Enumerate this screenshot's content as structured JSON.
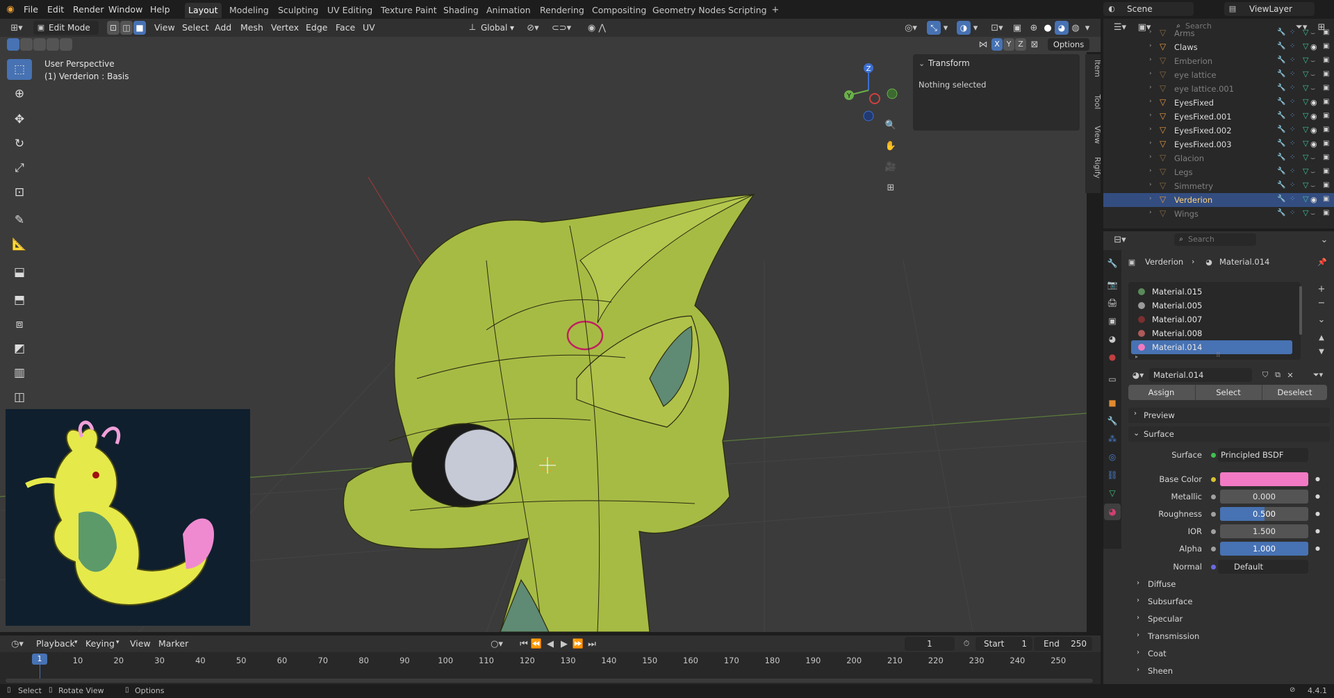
{
  "menus": {
    "file": "File",
    "edit": "Edit",
    "render": "Render",
    "window": "Window",
    "help": "Help"
  },
  "workspaces": [
    "Layout",
    "Modeling",
    "Sculpting",
    "UV Editing",
    "Texture Paint",
    "Shading",
    "Animation",
    "Rendering",
    "Compositing",
    "Geometry Nodes",
    "Scripting"
  ],
  "active_workspace": "Layout",
  "scene": {
    "label": "Scene"
  },
  "view_layer": {
    "label": "ViewLayer"
  },
  "viewport_header": {
    "mode": "Edit Mode",
    "view": "View",
    "select": "Select",
    "add": "Add",
    "mesh": "Mesh",
    "vertex": "Vertex",
    "edge": "Edge",
    "face": "Face",
    "uv": "UV",
    "orientation": "Global",
    "options": "Options",
    "x": "X",
    "y": "Y",
    "z": "Z"
  },
  "viewport": {
    "perspective": "User Perspective",
    "object_info": "(1) Verderion : Basis",
    "gizmo": {
      "z": "Z",
      "y": "Y"
    }
  },
  "npanel": {
    "title": "Transform",
    "status": "Nothing selected",
    "tabs": [
      "Item",
      "Tool",
      "View",
      "Rigify"
    ]
  },
  "outliner": {
    "search_placeholder": "Search",
    "items": [
      {
        "name": "Arms",
        "visible": false
      },
      {
        "name": "Claws",
        "visible": true
      },
      {
        "name": "Emberion",
        "visible": false
      },
      {
        "name": "eye lattice",
        "visible": false
      },
      {
        "name": "eye lattice.001",
        "visible": false
      },
      {
        "name": "EyesFixed",
        "visible": true
      },
      {
        "name": "EyesFixed.001",
        "visible": true
      },
      {
        "name": "EyesFixed.002",
        "visible": true
      },
      {
        "name": "EyesFixed.003",
        "visible": true
      },
      {
        "name": "Glacion",
        "visible": false
      },
      {
        "name": "Legs",
        "visible": false
      },
      {
        "name": "Simmetry",
        "visible": false
      },
      {
        "name": "Verderion",
        "visible": true,
        "selected": true
      },
      {
        "name": "Wings",
        "visible": false
      }
    ]
  },
  "properties": {
    "search_placeholder": "Search",
    "breadcrumb_object": "Verderion",
    "breadcrumb_material": "Material.014",
    "slots": [
      {
        "name": "Material.015",
        "color": "#5a8a5a"
      },
      {
        "name": "Material.005",
        "color": "#9a9a9a"
      },
      {
        "name": "Material.007",
        "color": "#7a3030"
      },
      {
        "name": "Material.008",
        "color": "#b05a5a"
      },
      {
        "name": "Material.014",
        "color": "#f07ac0",
        "selected": true
      }
    ],
    "material_name": "Material.014",
    "assign": "Assign",
    "select": "Select",
    "deselect": "Deselect",
    "preview": "Preview",
    "surface_section": "Surface",
    "surface_label": "Surface",
    "surface_value": "Principled BSDF",
    "base_color_label": "Base Color",
    "base_color": "#f27ac4",
    "metallic_label": "Metallic",
    "metallic": "0.000",
    "roughness_label": "Roughness",
    "roughness": "0.500",
    "roughness_fraction": 0.5,
    "ior_label": "IOR",
    "ior": "1.500",
    "alpha_label": "Alpha",
    "alpha": "1.000",
    "alpha_fraction": 1.0,
    "normal_label": "Normal",
    "normal_value": "Default",
    "subsections": [
      "Diffuse",
      "Subsurface",
      "Specular",
      "Transmission",
      "Coat",
      "Sheen"
    ]
  },
  "timeline": {
    "playback": "Playback",
    "keying": "Keying",
    "view": "View",
    "marker": "Marker",
    "current_frame": "1",
    "start_label": "Start",
    "start": "1",
    "end_label": "End",
    "end": "250",
    "ticks": [
      "10",
      "20",
      "30",
      "40",
      "50",
      "60",
      "70",
      "80",
      "90",
      "100",
      "110",
      "120",
      "130",
      "140",
      "150",
      "160",
      "170",
      "180",
      "190",
      "200",
      "210",
      "220",
      "230",
      "240",
      "250"
    ]
  },
  "statusbar": {
    "select": "Select",
    "rotate": "Rotate View",
    "options": "Options",
    "version": "4.4.1"
  },
  "colors": {
    "accent": "#4772b3",
    "model": "#a7bc44",
    "header": "#303030"
  }
}
